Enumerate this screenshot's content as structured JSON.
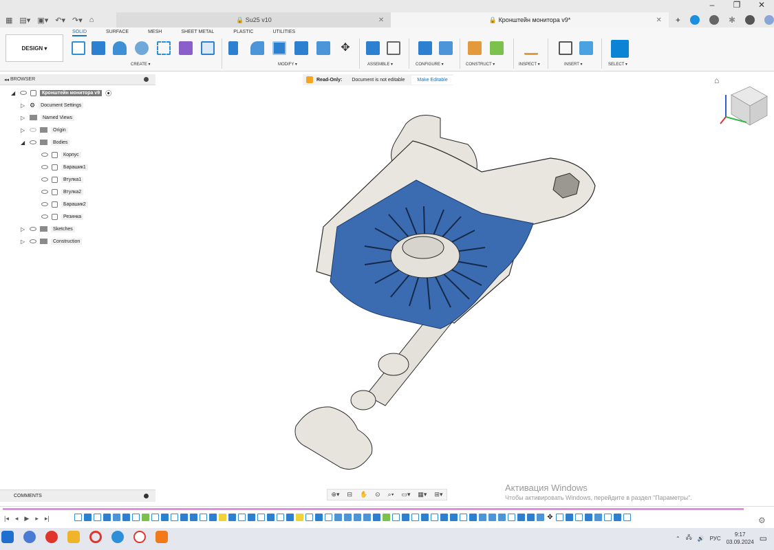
{
  "window": {
    "controls": [
      "–",
      "❐",
      "✕"
    ]
  },
  "tabs": [
    {
      "label": "Su25 v10",
      "close": "✕"
    },
    {
      "label": "Кронштейн монитора v9*",
      "close": "✕"
    }
  ],
  "toolbar": {
    "design_label": "DESIGN ▾",
    "workspace_tabs": [
      "SOLID",
      "SURFACE",
      "MESH",
      "SHEET METAL",
      "PLASTIC",
      "UTILITIES"
    ],
    "groups": {
      "create": "CREATE ▾",
      "modify": "MODIFY ▾",
      "assemble": "ASSEMBLE ▾",
      "configure": "CONFIGURE ▾",
      "construct": "CONSTRUCT ▾",
      "inspect": "INSPECT ▾",
      "insert": "INSERT ▾",
      "select": "SELECT ▾"
    }
  },
  "browser": {
    "title": "BROWSER",
    "root": "Кронштейн монитора v9",
    "items": [
      {
        "label": "Document Settings"
      },
      {
        "label": "Named Views"
      },
      {
        "label": "Origin"
      },
      {
        "label": "Bodies"
      },
      {
        "label": "Корпус"
      },
      {
        "label": "Барашик1"
      },
      {
        "label": "Втулка1"
      },
      {
        "label": "Втулка2"
      },
      {
        "label": "Барашик2"
      },
      {
        "label": "Резинка"
      },
      {
        "label": "Sketches"
      },
      {
        "label": "Construction"
      }
    ]
  },
  "banner": {
    "read_only": "Read-Only:",
    "message": "Document is not editable",
    "make_editable": "Make Editable"
  },
  "comments": {
    "label": "COMMENTS"
  },
  "activation": {
    "title": "Активация Windows",
    "subtitle": "Чтобы активировать Windows, перейдите в раздел \"Параметры\"."
  },
  "taskbar": {
    "lang": "РУС",
    "time": "9:17",
    "date": "03.09.2024"
  },
  "colors": {
    "accent": "#1a73b8",
    "body_main": "#e8e6df",
    "rubber": "#3b6bb0",
    "timeline": "#e08ee0"
  }
}
